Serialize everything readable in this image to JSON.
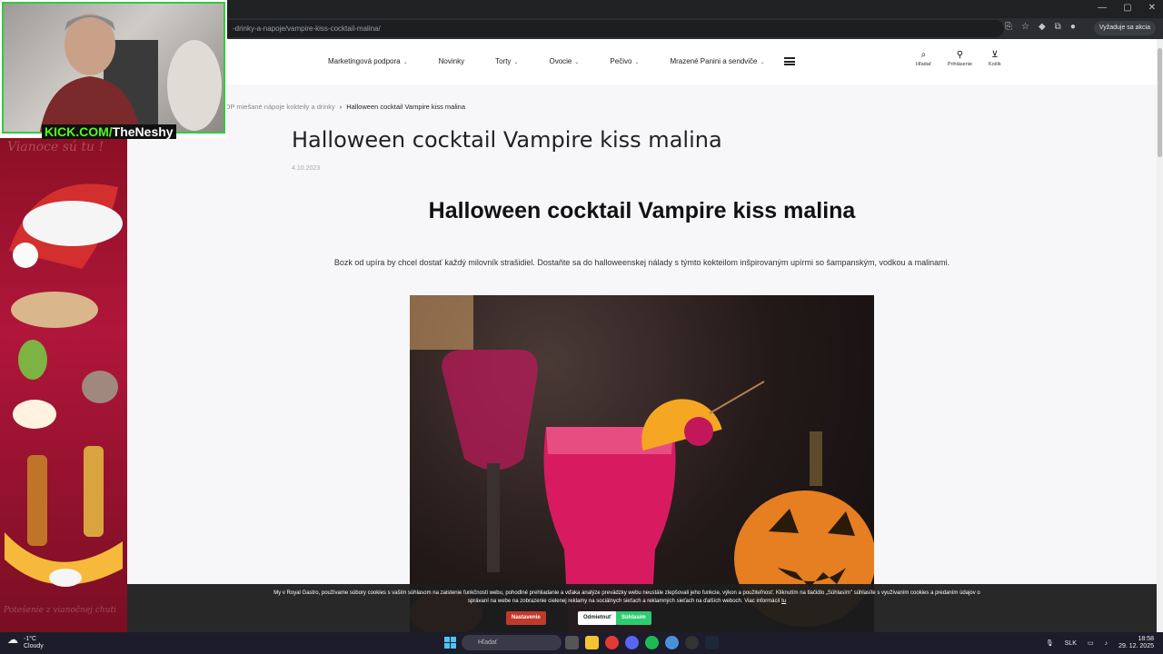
{
  "browser": {
    "url": "-drinky-a-napoje/vampire-kiss-cocktail-malina/",
    "update_button": "Vyžaduje sa akcia",
    "window_controls": [
      "—",
      "▢",
      "✕"
    ]
  },
  "site": {
    "nav": [
      {
        "label": "Marketingová podpora",
        "chev": "⌄"
      },
      {
        "label": "Novinky",
        "chev": ""
      },
      {
        "label": "Torty",
        "chev": "⌄"
      },
      {
        "label": "Ovocie",
        "chev": "⌄"
      },
      {
        "label": "Pečivo",
        "chev": "⌄"
      },
      {
        "label": "Mrazené Panini a sendviče",
        "chev": "⌄"
      }
    ],
    "header_icons": [
      {
        "icon": "search-icon",
        "glyph": "🔍",
        "label": "Hľadať"
      },
      {
        "icon": "user-icon",
        "glyph": "👤",
        "label": "Prihlásenie"
      },
      {
        "icon": "cart-icon",
        "glyph": "🛒",
        "label": "Košík"
      }
    ]
  },
  "breadcrumb": {
    "parent": "DP miešané nápoje kokteily a drinky",
    "separator": "›",
    "current": "Halloween cocktail Vampire kiss malina"
  },
  "article": {
    "title": "Halloween cocktail Vampire kiss malina",
    "date": "4.10.2023",
    "heading": "Halloween cocktail Vampire kiss malina",
    "intro": "Bozk od upíra by chcel dostať každý milovník strašidiel. Dostaňte sa do halloweenskej nálady s týmto kokteilom inšpirovaným upírmi so šampanským, vodkou a malinami."
  },
  "sidebar_banner": {
    "heading": "Vianoce sú tu !",
    "footer": "Potešenie z vianočnej chuti"
  },
  "stream": {
    "kick_prefix": "KICK.COM/",
    "channel": "TheNeshy"
  },
  "cookie": {
    "text_1": "My v Royal Gastro, používame súbory cookies s vaším súhlasom na zaistenie funkčnosti webu, pohodlné prehliadanie a vďaka analýze prevádzky webu neustále zlepšovali jeho funkcie, výkon a použiteľnosť. Kliknutím na tlačidlo",
    "text_2": "„Súhlasím\" súhlasíte s využívaním cookies a predaním údajov o správaní na webe na zobrazenie cielenej reklamy na sociálnych sieťach a reklamných sieťach na ďalších weboch. Viac informácií",
    "link": "tu",
    "settings_button": "Nastavenie",
    "reject_button": "Odmietnuť",
    "accept_button": "Súhlasím"
  },
  "taskbar": {
    "temp": "-1°C",
    "weather": "Cloudy",
    "search_placeholder": "Hľadať",
    "lang": "SLK",
    "time": "18:58",
    "date": "29. 12. 2025"
  },
  "colors": {
    "accept": "#2ecc71",
    "settings": "#c0392b",
    "kick_green": "#53fc18"
  }
}
